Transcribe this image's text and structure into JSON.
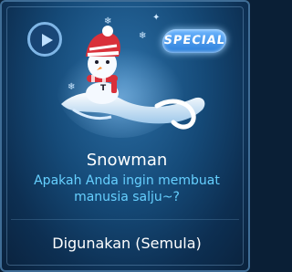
{
  "card": {
    "badge": "SPECIAL",
    "title": "Snowman",
    "description": "Apakah Anda ingin membuat manusia salju~?",
    "status": "Digunakan (Semula)"
  },
  "colors": {
    "accent": "#66d0ff",
    "border": "#3f6d96"
  }
}
